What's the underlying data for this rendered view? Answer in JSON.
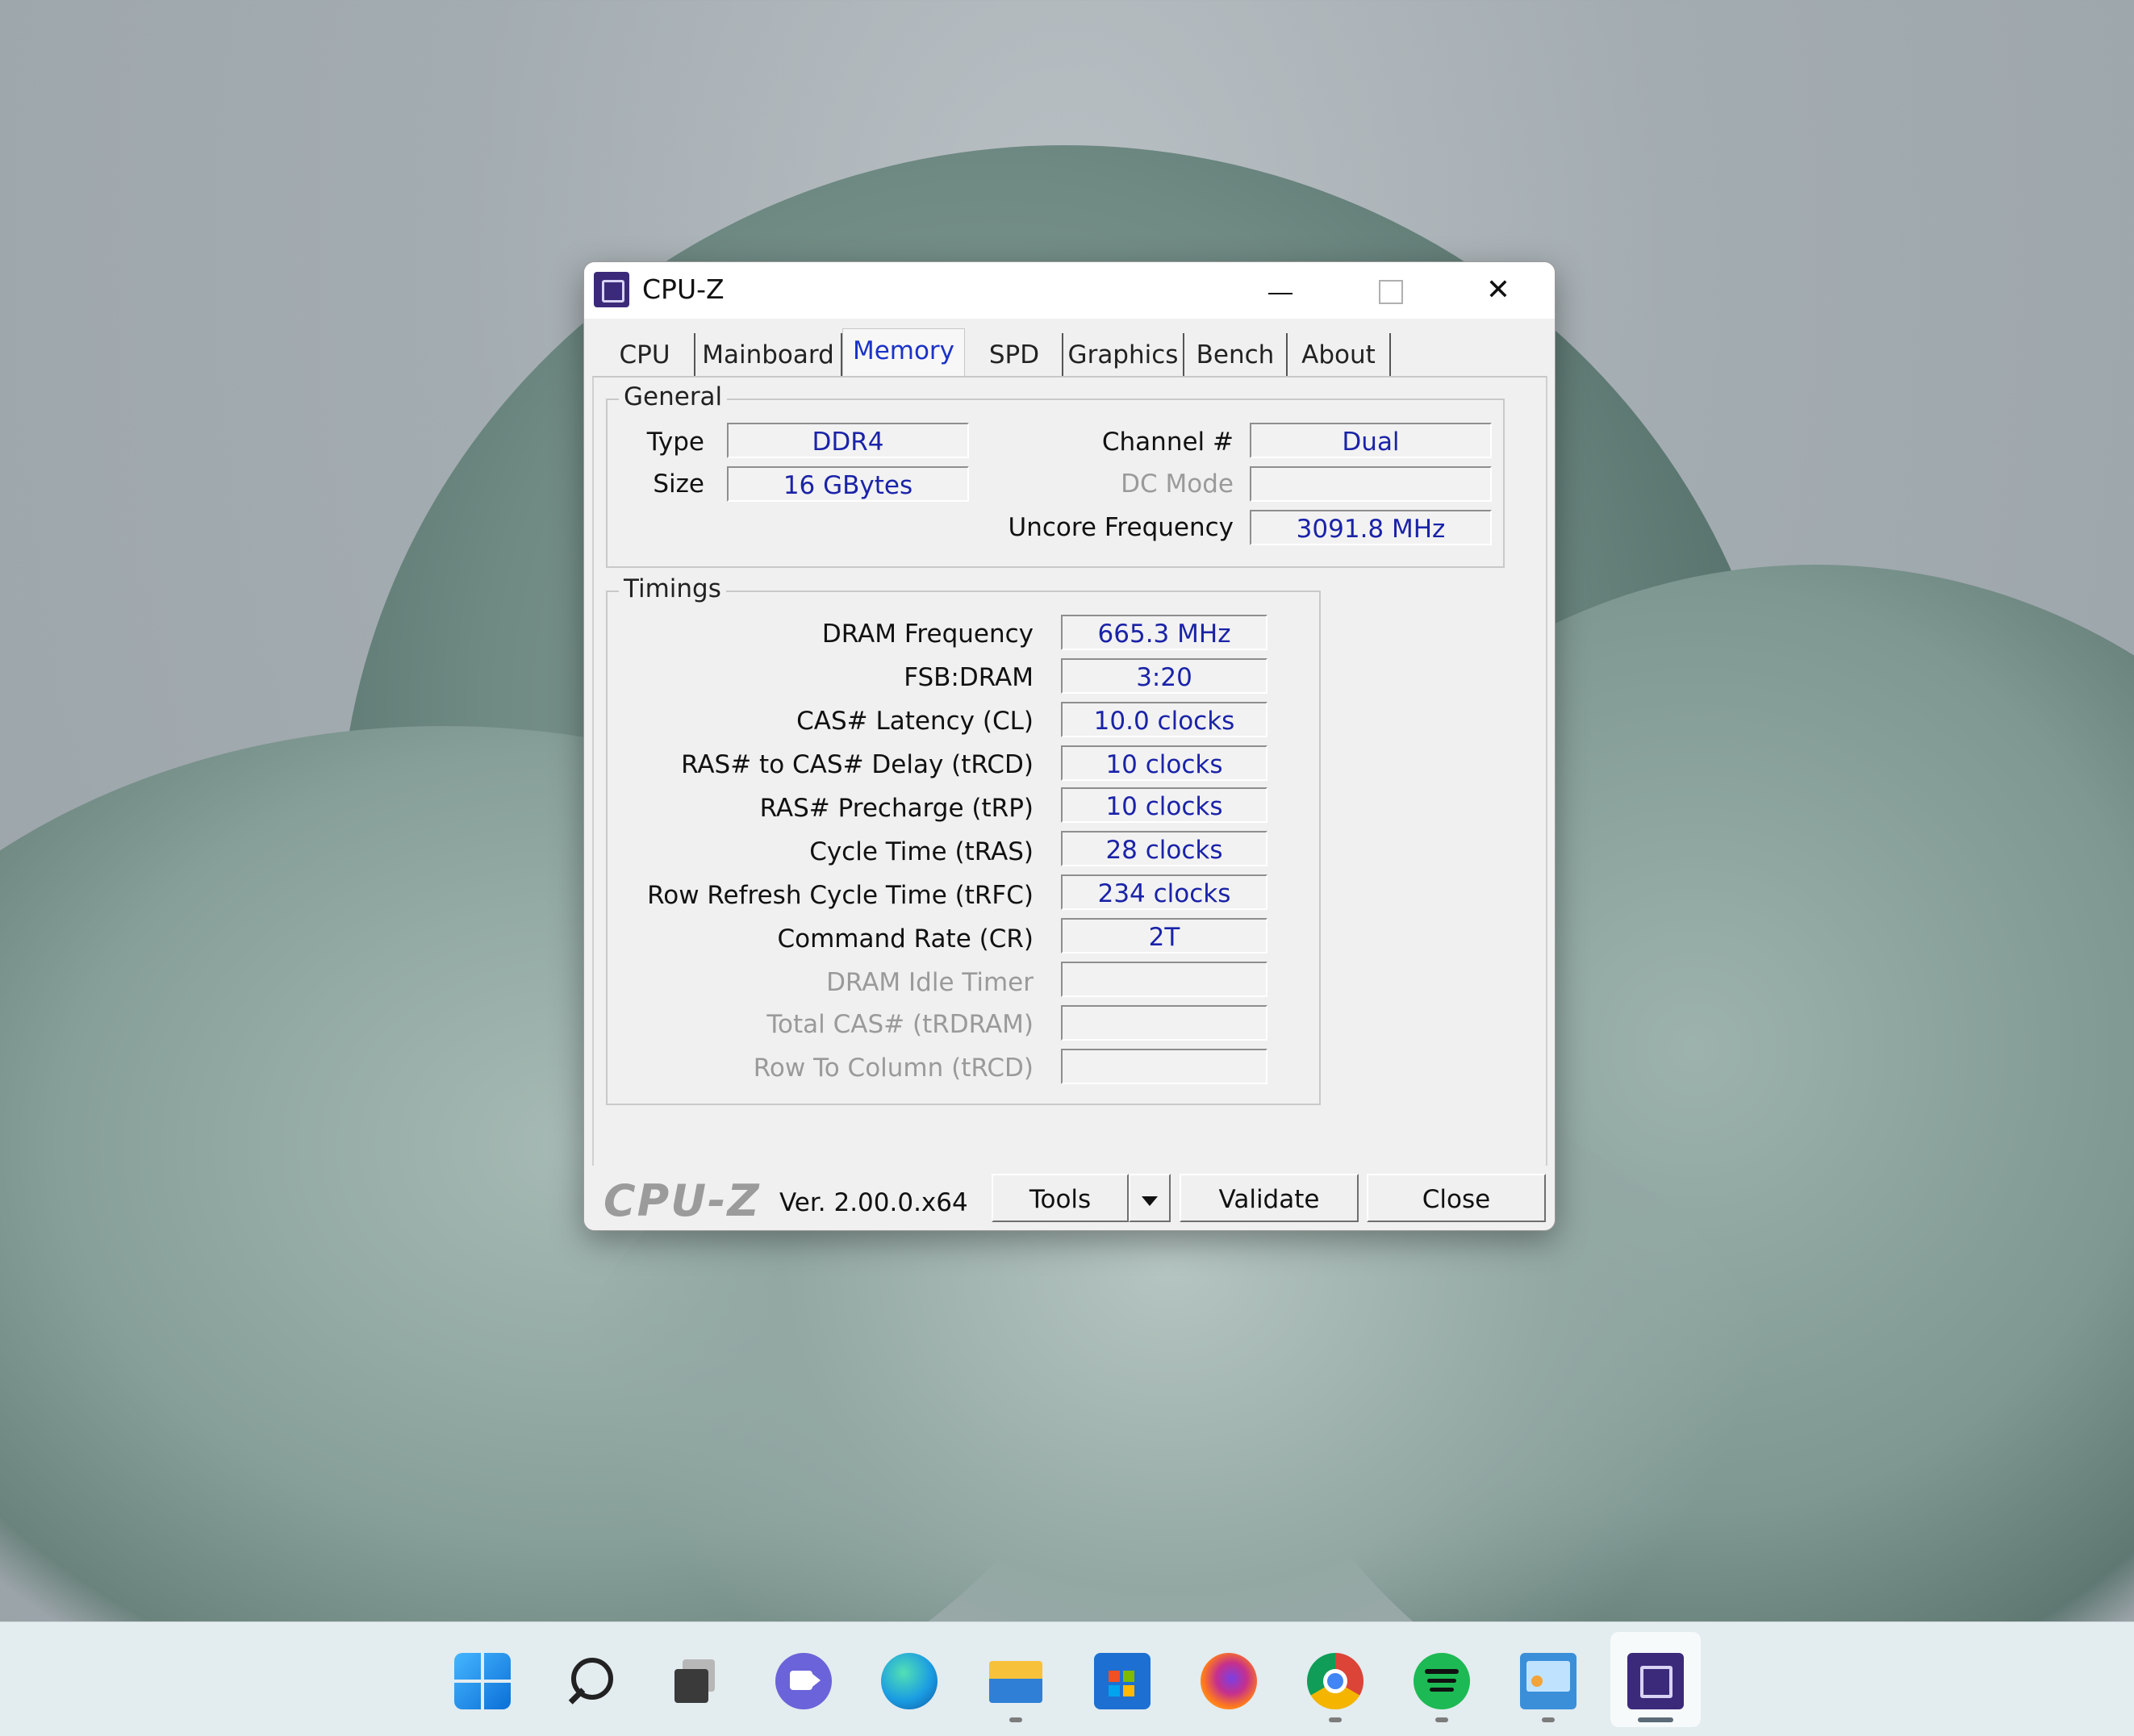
{
  "window": {
    "title": "CPU-Z",
    "controls": {
      "minimize": "",
      "maximize": "",
      "close": "✕"
    }
  },
  "tabs": [
    "CPU",
    "Mainboard",
    "Memory",
    "SPD",
    "Graphics",
    "Bench",
    "About"
  ],
  "active_tab": "Memory",
  "general": {
    "title": "General",
    "type_label": "Type",
    "type_value": "DDR4",
    "size_label": "Size",
    "size_value": "16 GBytes",
    "channel_label": "Channel #",
    "channel_value": "Dual",
    "dcmode_label": "DC Mode",
    "dcmode_value": "",
    "uncore_label": "Uncore Frequency",
    "uncore_value": "3091.8 MHz"
  },
  "timings": {
    "title": "Timings",
    "rows": [
      {
        "label": "DRAM Frequency",
        "value": "665.3 MHz",
        "enabled": true
      },
      {
        "label": "FSB:DRAM",
        "value": "3:20",
        "enabled": true
      },
      {
        "label": "CAS# Latency (CL)",
        "value": "10.0 clocks",
        "enabled": true
      },
      {
        "label": "RAS# to CAS# Delay (tRCD)",
        "value": "10 clocks",
        "enabled": true
      },
      {
        "label": "RAS# Precharge (tRP)",
        "value": "10 clocks",
        "enabled": true
      },
      {
        "label": "Cycle Time (tRAS)",
        "value": "28 clocks",
        "enabled": true
      },
      {
        "label": "Row Refresh Cycle Time (tRFC)",
        "value": "234 clocks",
        "enabled": true
      },
      {
        "label": "Command Rate (CR)",
        "value": "2T",
        "enabled": true
      },
      {
        "label": "DRAM Idle Timer",
        "value": "",
        "enabled": false
      },
      {
        "label": "Total CAS# (tRDRAM)",
        "value": "",
        "enabled": false
      },
      {
        "label": "Row To Column (tRCD)",
        "value": "",
        "enabled": false
      }
    ]
  },
  "footer": {
    "logo": "CPU-Z",
    "version": "Ver. 2.00.0.x64",
    "tools_label": "Tools",
    "validate_label": "Validate",
    "close_label": "Close"
  },
  "taskbar": {
    "icons": [
      {
        "name": "windows-start-icon",
        "color": "#1a8fe8"
      },
      {
        "name": "search-icon",
        "color": "#222222"
      },
      {
        "name": "task-view-icon",
        "color": "#333333"
      },
      {
        "name": "teams-chat-icon",
        "color": "#6264d8"
      },
      {
        "name": "edge-browser-icon",
        "color": "#1b9de2"
      },
      {
        "name": "file-explorer-icon",
        "color": "#f5c242"
      },
      {
        "name": "microsoft-store-icon",
        "color": "#1d6fd1"
      },
      {
        "name": "firefox-icon",
        "color": "#ff6a1c"
      },
      {
        "name": "chrome-icon",
        "color": "#db4437"
      },
      {
        "name": "spotify-icon",
        "color": "#1db954"
      },
      {
        "name": "control-panel-icon",
        "color": "#3a8fd8"
      },
      {
        "name": "cpu-z-taskbar-icon",
        "color": "#3b2a7a"
      }
    ]
  }
}
